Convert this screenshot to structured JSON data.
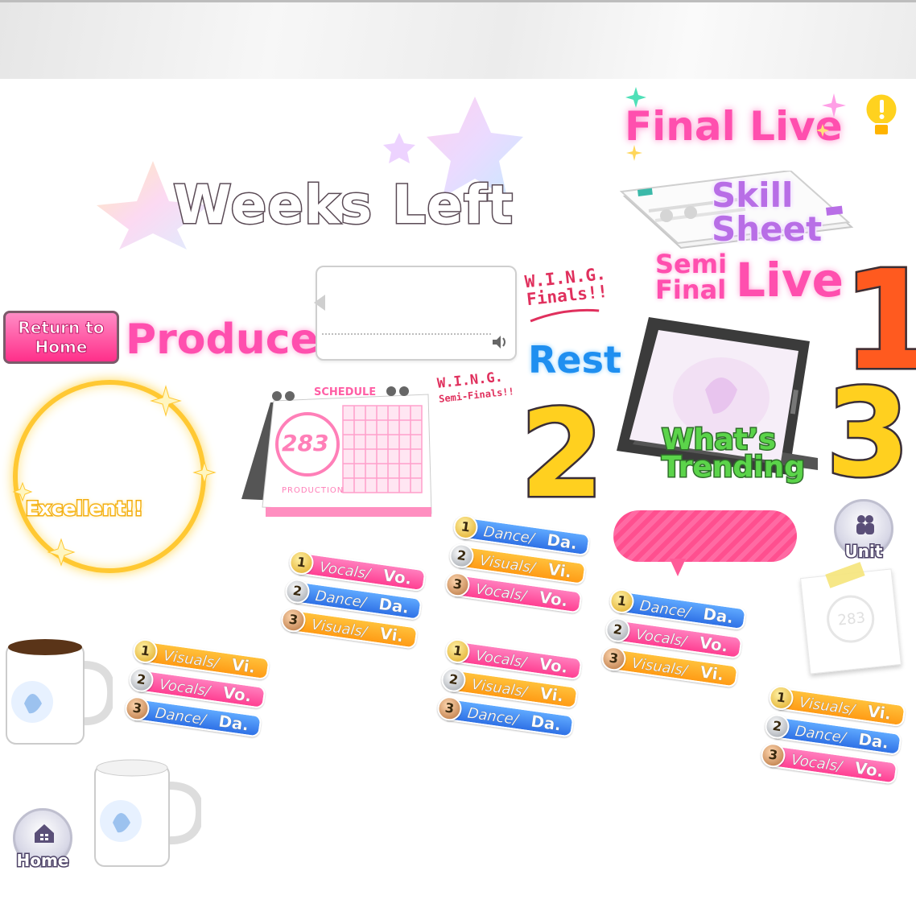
{
  "labels": {
    "weeks_left": "Weeks Left",
    "final_live": "Final Live",
    "skill": "Skill",
    "sheet": "Sheet",
    "semi": "Semi",
    "final": "Final",
    "live": "Live",
    "produce": "Produce",
    "rest": "Rest",
    "whats": "What’s",
    "trending": "Trending",
    "excellent": "Excellent!!",
    "wing_finals_1": "W.I.N.G.",
    "wing_finals_2": "Finals!!",
    "wing_semi_1": "W.I.N.G.",
    "wing_semi_2": "Semi-Finals!!",
    "schedule": "SCHEDULE",
    "production": "PRODUCTION",
    "calendar_number": "283"
  },
  "numbers": {
    "one": "1",
    "two": "2",
    "three": "3"
  },
  "buttons": {
    "return_home": "Return to Home",
    "unit": "Unit",
    "home": "Home"
  },
  "icons": {
    "speaker": "speaker-icon",
    "lightbulb": "lightbulb-icon",
    "home": "house-icon",
    "unit": "people-icon"
  },
  "colors": {
    "pink": "#ff4fae",
    "blue": "#1f8ff0",
    "green": "#5bd44a",
    "gold": "#ffc832"
  },
  "stat_sets": [
    {
      "rows": [
        {
          "rank": "1",
          "name": "Visuals/",
          "abbr": "Vi."
        },
        {
          "rank": "2",
          "name": "Vocals/",
          "abbr": "Vo."
        },
        {
          "rank": "3",
          "name": "Dance/",
          "abbr": "Da."
        }
      ]
    },
    {
      "rows": [
        {
          "rank": "1",
          "name": "Vocals/",
          "abbr": "Vo."
        },
        {
          "rank": "2",
          "name": "Dance/",
          "abbr": "Da."
        },
        {
          "rank": "3",
          "name": "Visuals/",
          "abbr": "Vi."
        }
      ]
    },
    {
      "rows": [
        {
          "rank": "1",
          "name": "Dance/",
          "abbr": "Da."
        },
        {
          "rank": "2",
          "name": "Visuals/",
          "abbr": "Vi."
        },
        {
          "rank": "3",
          "name": "Vocals/",
          "abbr": "Vo."
        }
      ]
    },
    {
      "rows": [
        {
          "rank": "1",
          "name": "Vocals/",
          "abbr": "Vo."
        },
        {
          "rank": "2",
          "name": "Visuals/",
          "abbr": "Vi."
        },
        {
          "rank": "3",
          "name": "Dance/",
          "abbr": "Da."
        }
      ]
    },
    {
      "rows": [
        {
          "rank": "1",
          "name": "Dance/",
          "abbr": "Da."
        },
        {
          "rank": "2",
          "name": "Vocals/",
          "abbr": "Vo."
        },
        {
          "rank": "3",
          "name": "Visuals/",
          "abbr": "Vi."
        }
      ]
    },
    {
      "rows": [
        {
          "rank": "1",
          "name": "Visuals/",
          "abbr": "Vi."
        },
        {
          "rank": "2",
          "name": "Dance/",
          "abbr": "Da."
        },
        {
          "rank": "3",
          "name": "Vocals/",
          "abbr": "Vo."
        }
      ]
    }
  ]
}
